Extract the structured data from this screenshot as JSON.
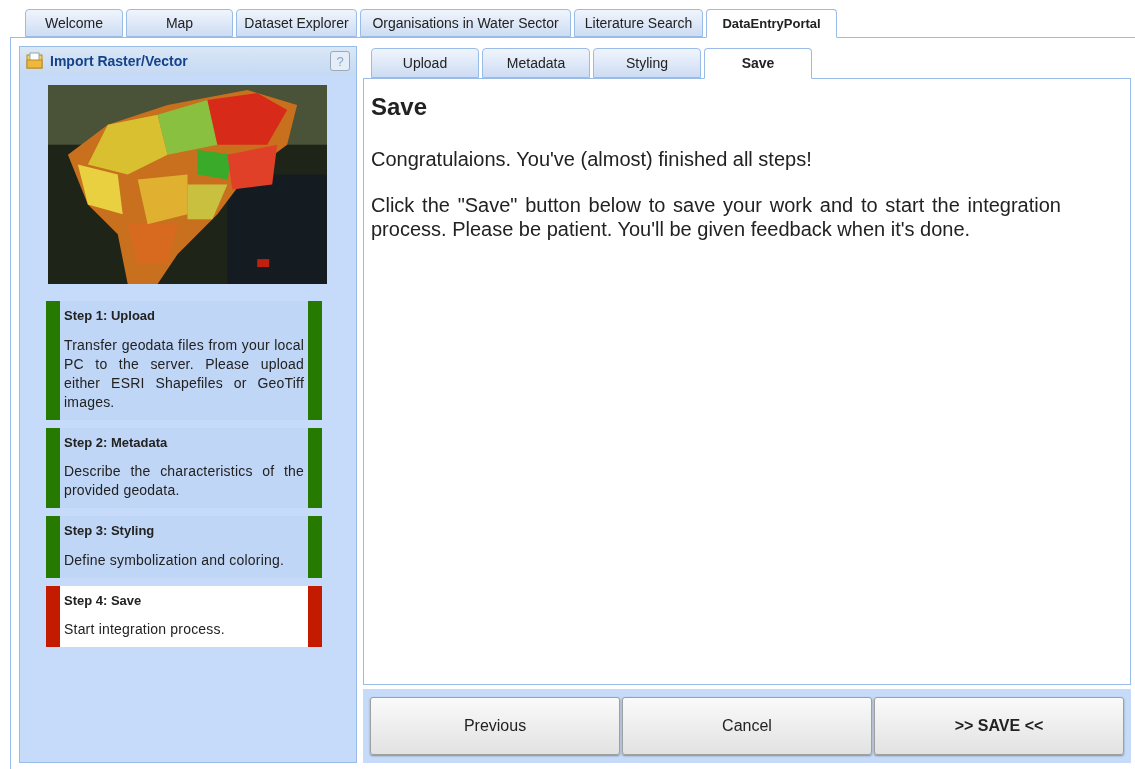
{
  "main_tabs": [
    {
      "label": "Welcome",
      "selected": false
    },
    {
      "label": "Map",
      "selected": false
    },
    {
      "label": "Dataset Explorer",
      "selected": false
    },
    {
      "label": "Organisations in Water Sector",
      "selected": false
    },
    {
      "label": "Literature Search",
      "selected": false
    },
    {
      "label": "DataEntryPortal",
      "selected": true
    }
  ],
  "side_panel": {
    "title": "Import Raster/Vector",
    "help": "?",
    "steps": [
      {
        "title": "Step 1: Upload",
        "text": "Transfer geodata files from your local PC to the server. Please upload either ESRI Shapefiles or GeoTiff images.",
        "color": "#267a00",
        "selected": false
      },
      {
        "title": "Step 2: Metadata",
        "text": "Describe the characteristics of the provided geodata.",
        "color": "#267a00",
        "selected": false
      },
      {
        "title": "Step 3: Styling",
        "text": "Define symbolization and coloring.",
        "color": "#267a00",
        "selected": false
      },
      {
        "title": "Step 4: Save",
        "text": "Start integration process.",
        "color": "#c41a00",
        "selected": true
      }
    ]
  },
  "wizard_tabs": [
    {
      "label": "Upload",
      "selected": false
    },
    {
      "label": "Metadata",
      "selected": false
    },
    {
      "label": "Styling",
      "selected": false
    },
    {
      "label": "Save",
      "selected": true
    }
  ],
  "content": {
    "heading": "Save",
    "paragraphs": [
      "Congratulaions. You've (almost) finished all steps!",
      "Click the \"Save\" button below to save your work and to start the integration process. Please be patient. You'll be given feedback when it's done."
    ]
  },
  "buttons": [
    {
      "label": "Previous",
      "kind": "normal"
    },
    {
      "label": "Cancel",
      "kind": "normal"
    },
    {
      "label": ">> SAVE <<",
      "kind": "primary"
    }
  ]
}
